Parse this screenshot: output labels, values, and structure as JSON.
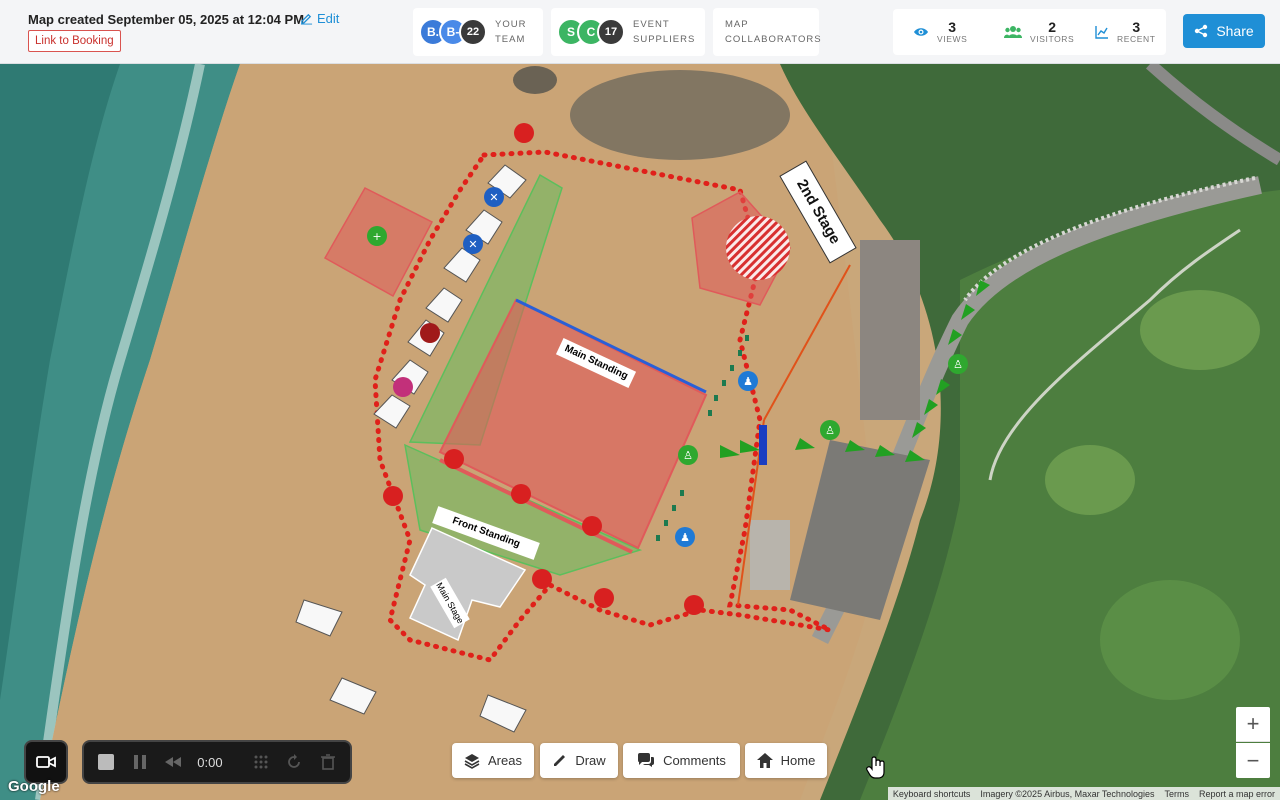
{
  "header": {
    "created_text": "Map created September 05, 2025 at 12:04 PM",
    "edit_label": "Edit",
    "booking_link": "Link to Booking"
  },
  "team": {
    "avatars": [
      {
        "initials": "B.",
        "color": "#3b7bd9"
      },
      {
        "initials": "B-",
        "color": "#4a8ae8"
      }
    ],
    "count": "22",
    "label_line1": "Your",
    "label_line2": "Team"
  },
  "suppliers": {
    "avatars": [
      {
        "initials": "S",
        "color": "#3cb563"
      },
      {
        "initials": "C",
        "color": "#3cb563"
      }
    ],
    "count": "17",
    "label_line1": "Event",
    "label_line2": "Suppliers"
  },
  "collaborators": {
    "label_line1": "Map",
    "label_line2": "Collaborators"
  },
  "stats": {
    "views": {
      "value": "3",
      "label": "Views",
      "icon": "eye-icon"
    },
    "visitors": {
      "value": "2",
      "label": "Visitors",
      "icon": "users-icon"
    },
    "recent": {
      "value": "3",
      "label": "Recent",
      "icon": "chart-icon"
    }
  },
  "share_label": "Share",
  "recorder": {
    "time": "0:00"
  },
  "toolbar": {
    "areas": "Areas",
    "draw": "Draw",
    "comments": "Comments",
    "home": "Home"
  },
  "zoom": {
    "in": "+",
    "out": "−"
  },
  "map_labels": {
    "main_standing": "Main Standing",
    "front_standing": "Front Standing",
    "main_stage": "Main Stage",
    "second_stage": "2nd Stage"
  },
  "footer": {
    "google": "Google",
    "shortcuts": "Keyboard shortcuts",
    "imagery": "Imagery ©2025 Airbus, Maxar Technologies",
    "terms": "Terms",
    "report": "Report a map error"
  },
  "colors": {
    "accent": "#1f8fd6",
    "zone_red": "#e05a5a",
    "zone_green": "#5cbf5c",
    "route_green": "#2fa82f",
    "boundary": "#e0201a"
  }
}
